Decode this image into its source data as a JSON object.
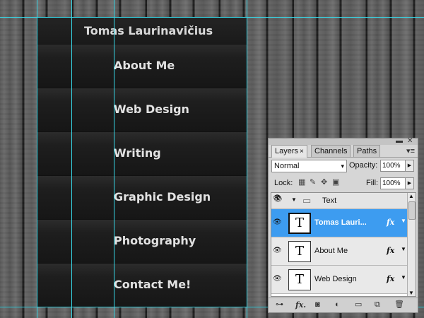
{
  "site": {
    "title": "Tomas Laurinavičius",
    "menu": [
      "About Me",
      "Web Design",
      "Writing",
      "Graphic Design",
      "Photography",
      "Contact Me!"
    ]
  },
  "colors": {
    "guide": "#37d8e8",
    "selection": "#3d9cf0"
  },
  "layers_panel": {
    "tabs": [
      {
        "label": "Layers",
        "active": true
      },
      {
        "label": "Channels",
        "active": false
      },
      {
        "label": "Paths",
        "active": false
      }
    ],
    "blend_mode": "Normal",
    "opacity_label": "Opacity:",
    "opacity_value": "100%",
    "lock_label": "Lock:",
    "fill_label": "Fill:",
    "fill_value": "100%",
    "group_name": "Text",
    "layers": [
      {
        "name": "Tomas Lauri...",
        "thumb": "T",
        "fx": "fx",
        "selected": true
      },
      {
        "name": "About Me",
        "thumb": "T",
        "fx": "fx",
        "selected": false
      },
      {
        "name": "Web Design",
        "thumb": "T",
        "fx": "fx",
        "selected": false
      }
    ],
    "icons": [
      "link-icon",
      "fx-icon",
      "mask-icon",
      "adjustment-icon",
      "folder-icon",
      "new-layer-icon",
      "trash-icon"
    ]
  }
}
